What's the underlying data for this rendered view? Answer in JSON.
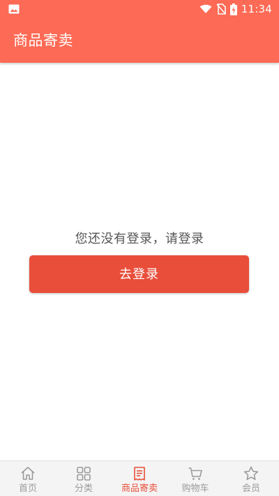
{
  "status_bar": {
    "time": "11:34"
  },
  "app_bar": {
    "title": "商品寄卖"
  },
  "main": {
    "prompt": "您还没有登录，请登录",
    "login_button": "去登录"
  },
  "tab_bar": {
    "items": [
      {
        "label": "首页",
        "icon": "home-icon"
      },
      {
        "label": "分类",
        "icon": "grid-icon"
      },
      {
        "label": "商品寄卖",
        "icon": "receipt-icon",
        "active": true
      },
      {
        "label": "购物车",
        "icon": "cart-icon"
      },
      {
        "label": "会员",
        "icon": "star-icon"
      }
    ]
  },
  "colors": {
    "primary": "#fd6a55",
    "button": "#e84e3a",
    "active_tab": "#e84e3a",
    "inactive_tab": "#9a9a9a"
  }
}
